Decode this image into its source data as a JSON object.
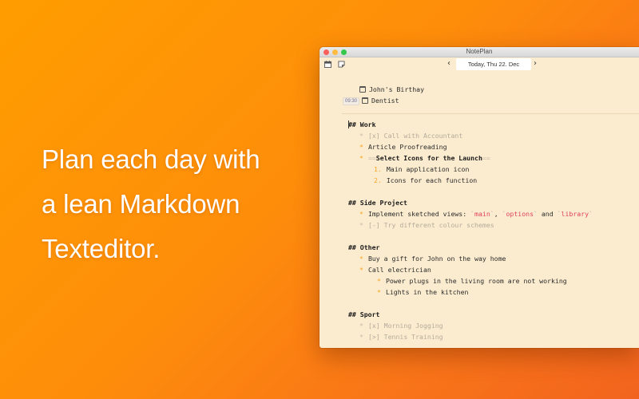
{
  "tagline": {
    "lines": [
      "Plan each day with",
      "a lean Markdown",
      "Texteditor."
    ]
  },
  "window": {
    "title": "NotePlan",
    "toolbar": {
      "calendar_icon": "calendar-icon",
      "notes_icon": "note-icon",
      "prev_label": "‹",
      "next_label": "›",
      "date_label": "Today, Thu 22. Dec"
    },
    "events": [
      {
        "time": "",
        "icon": "calendar-icon",
        "title": "John's Birthay"
      },
      {
        "time": "09:30",
        "icon": "calendar-icon",
        "title": "Dentist"
      }
    ],
    "sections": {
      "work": {
        "heading_hash": "##",
        "heading": "Work",
        "items": [
          {
            "marker": "*",
            "status": "[x]",
            "text": "Call with Accountant",
            "done": true
          },
          {
            "marker": "*",
            "text": "Article Proofreading"
          },
          {
            "marker": "*",
            "open": "==",
            "text": "Select Icons for the Launch",
            "close": "=="
          }
        ],
        "sub_items": [
          {
            "num": "1.",
            "text": "Main application icon"
          },
          {
            "num": "2.",
            "text": "Icons for each function"
          }
        ]
      },
      "side_project": {
        "heading_hash": "##",
        "heading": "Side Project",
        "item1": {
          "marker": "*",
          "prefix": "Implement sketched views: ",
          "code1": "main",
          "sep1": ", ",
          "code2": "options",
          "sep2": " and ",
          "code3": "library",
          "tick": "`"
        },
        "item2": {
          "marker": "*",
          "status": "[-]",
          "text": "Try different colour schemes",
          "done": true
        }
      },
      "other": {
        "heading_hash": "##",
        "heading": "Other",
        "items": [
          {
            "marker": "*",
            "text": "Buy a gift for John on the way home"
          },
          {
            "marker": "*",
            "text": "Call electrician"
          }
        ],
        "sub_items": [
          {
            "marker": "*",
            "text": "Power plugs in the living room are not working"
          },
          {
            "marker": "*",
            "text": "Lights in the kitchen"
          }
        ]
      },
      "sport": {
        "heading_hash": "##",
        "heading": "Sport",
        "items": [
          {
            "marker": "*",
            "status": "[x]",
            "text": "Morning Jogging",
            "done": true
          },
          {
            "marker": "*",
            "status": "[>]",
            "text": "Tennis Training",
            "done": true
          }
        ]
      }
    },
    "colors": {
      "accent": "#f5a623",
      "code": "#e0405a",
      "editor_bg": "#fbeccf",
      "done_text": "#b5ab9c"
    }
  }
}
